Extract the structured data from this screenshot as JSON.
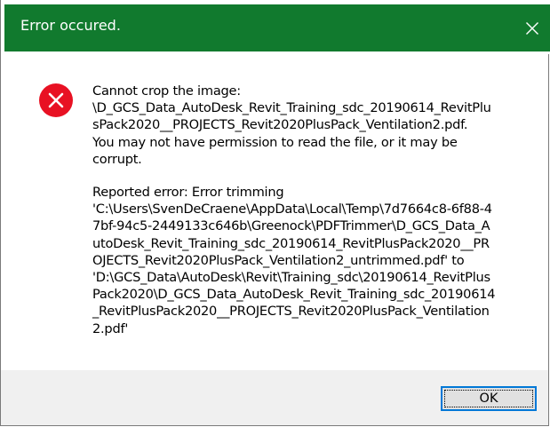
{
  "dialog": {
    "title": "Error occured.",
    "close_icon": "close-icon",
    "title_bar_color": "#117a2e",
    "error_icon": "error-icon",
    "error_icon_color": "#e81123",
    "message_lines": [
      "Cannot crop the image:",
      "\\D_GCS_Data_AutoDesk_Revit_Training_sdc_20190614_RevitPlu",
      "sPack2020__PROJECTS_Revit2020PlusPack_Ventilation2.pdf.",
      "You may not have permission to read the file, or it may be",
      "corrupt."
    ],
    "error_lines": [
      "Reported error: Error trimming",
      "'C:\\Users\\SvenDeCraene\\AppData\\Local\\Temp\\7d7664c8-6f88-4",
      "7bf-94c5-2449133c646b\\Greenock\\PDFTrimmer\\D_GCS_Data_A",
      "utoDesk_Revit_Training_sdc_20190614_RevitPlusPack2020__PR",
      "OJECTS_Revit2020PlusPack_Ventilation2_untrimmed.pdf' to",
      "'D:\\GCS_Data\\AutoDesk\\Revit\\Training_sdc\\20190614_RevitPlus",
      "Pack2020\\D_GCS_Data_AutoDesk_Revit_Training_sdc_20190614",
      "_RevitPlusPack2020__PROJECTS_Revit2020PlusPack_Ventilation",
      "2.pdf'"
    ],
    "ok_label": "OK"
  }
}
